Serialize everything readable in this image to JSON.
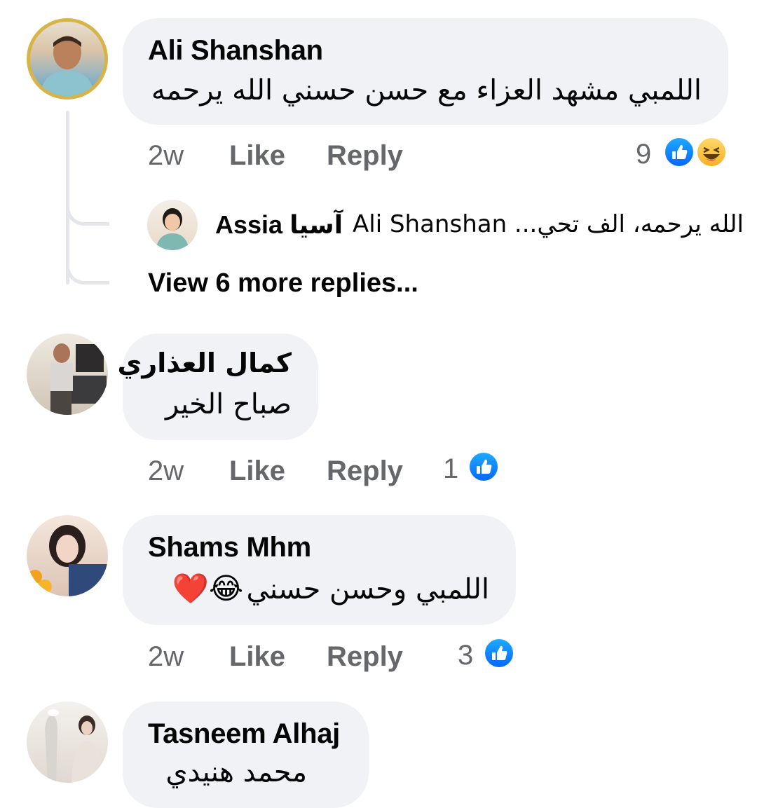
{
  "comments": [
    {
      "author": "Ali Shanshan",
      "text": "اللمبي مشهد العزاء مع حسن حسني الله يرحمه",
      "time": "2w",
      "like_label": "Like",
      "reply_label": "Reply",
      "reaction_count": "9",
      "reactions": [
        "like-icon",
        "haha-icon"
      ]
    },
    {
      "author": "كمال العذاري",
      "text": "صباح الخير",
      "time": "2w",
      "like_label": "Like",
      "reply_label": "Reply",
      "reaction_count": "1",
      "reactions": [
        "like-icon"
      ]
    },
    {
      "author": "Shams Mhm",
      "text": "اللمبي وحسن حسني",
      "text_emoji": "😂❤️",
      "time": "2w",
      "like_label": "Like",
      "reply_label": "Reply",
      "reaction_count": "3",
      "reactions": [
        "like-icon"
      ]
    },
    {
      "author": "Tasneem Alhaj",
      "text": "محمد هنيدي"
    }
  ],
  "reply_preview": {
    "author": "Assia آسيا",
    "text": "Ali Shanshan ...الله يرحمه، الف تحي"
  },
  "view_more_label": "View 6 more replies...",
  "colors": {
    "bubble": "#f0f2f5",
    "meta_text": "#65676b",
    "like_blue": "#0866ff",
    "thread_line": "#e4e6eb"
  }
}
